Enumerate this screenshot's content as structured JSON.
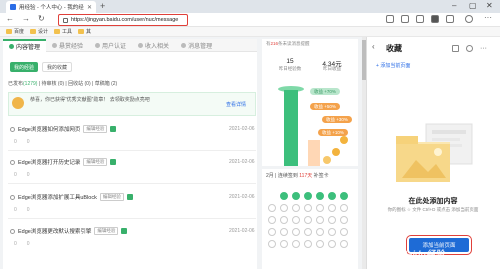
{
  "browser": {
    "tab_title": "用经验 - 个人中心 - 我的经验",
    "url": "https://jingyan.baidu.com/user/nuc/message",
    "bookmarks": [
      "百度",
      "设计",
      "工具",
      "其"
    ]
  },
  "page": {
    "tabs": [
      "内容管理",
      "悬赏经验",
      "用户认证",
      "收入相关",
      "消息管理"
    ],
    "btn_primary": "我的经验",
    "btn_secondary": "我的收藏",
    "stats": {
      "prefix": "已发布",
      "published": "(1279)",
      "rest": "| 待审核 (0) | 回收站 (0) | 草稿箱 (2)"
    },
    "notice_text": "恭喜，你已获得“优秀文献图”勋章！ 去领取奖励点亮吧",
    "notice_link": "查看详情",
    "rows": [
      {
        "title": "Edge浏览器如何添加网页",
        "tag": "编辑经验",
        "date": "2021-02-06",
        "views": "0",
        "likes": "0"
      },
      {
        "title": "Edge浏览器打开历史记录",
        "tag": "编辑经验",
        "date": "2021-02-06",
        "views": "0",
        "likes": "0"
      },
      {
        "title": "Edge浏览器添加扩展工具uBlock",
        "tag": "编辑经验",
        "date": "2021-02-06",
        "views": "0",
        "likes": "0"
      },
      {
        "title": "Edge浏览器更改默认搜索引擎",
        "tag": "编辑经验",
        "date": "2021-02-06",
        "views": "0",
        "likes": "0"
      }
    ]
  },
  "widget": {
    "note_pre": "有",
    "note_num": "216",
    "note_post": "条未读消息提醒",
    "stat1": {
      "value": "15",
      "label": "昨日经验数"
    },
    "stat2": {
      "value": "4.34元",
      "label": "昨日收益"
    },
    "pills": [
      "收益 +70%",
      "收益 +50%",
      "收益 +30%",
      "收益 +10%"
    ],
    "calendar": {
      "month": "2月",
      "label": "连续签到",
      "days": "117天",
      "suffix": "补签卡"
    }
  },
  "panel": {
    "title": "收藏",
    "add_page": "添加当前页面",
    "empty_title": "在此处添加内容",
    "empty_desc": "你的图标 ☆ 文件 Ctrl+D 或点击 添加当前页面",
    "add_button": "添加当前页面",
    "watermark": "Baidu经验"
  },
  "colors": {
    "accent": "#38b06b",
    "highlight": "#e0403a",
    "link": "#2b6de6",
    "button": "#1e6bd6"
  }
}
